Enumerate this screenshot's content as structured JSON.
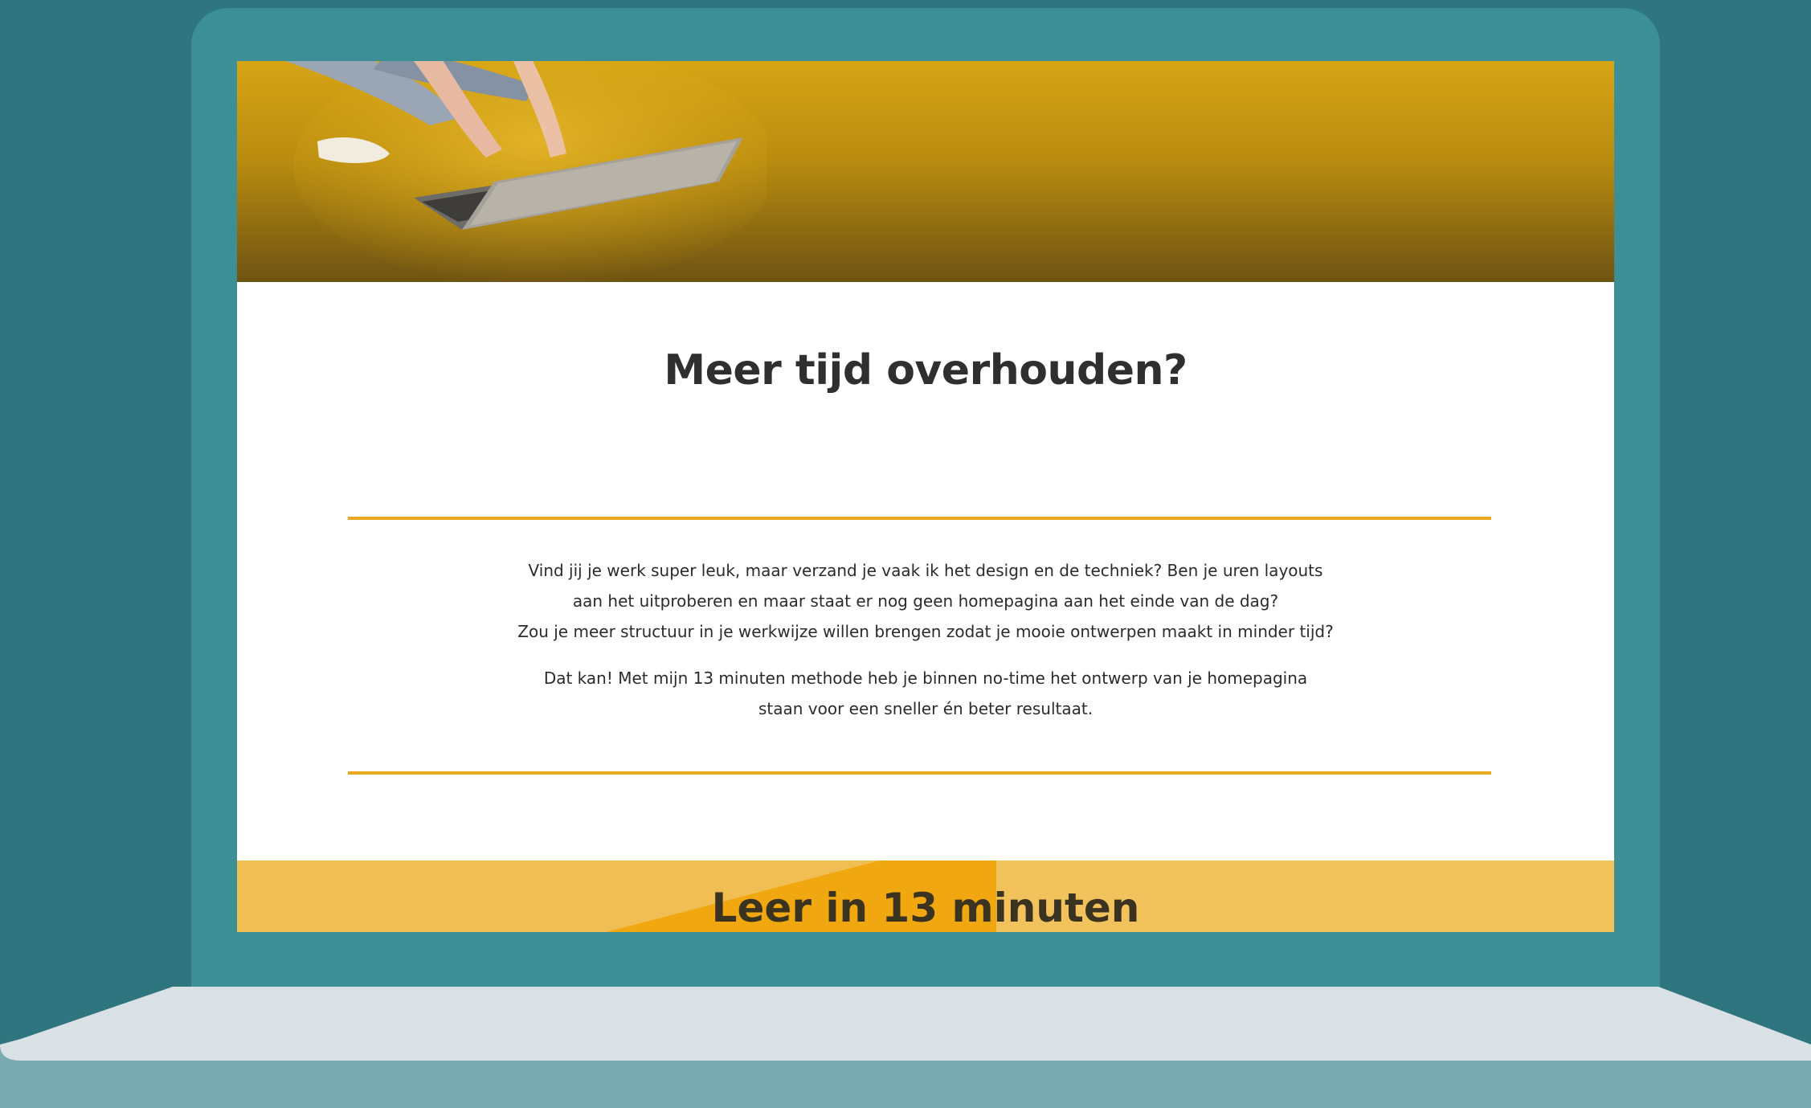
{
  "hero": {
    "image_description": "person-typing-on-laptop-photo"
  },
  "main": {
    "title": "Meer tijd overhouden?",
    "paragraph_1_lines": [
      "Vind jij je werk super leuk, maar verzand je vaak ik het design en de techniek? Ben je uren layouts",
      "aan het uitproberen en maar staat er nog geen homepagina aan het einde van de dag?",
      "Zou je meer structuur in je werkwijze willen brengen zodat je mooie ontwerpen maakt in minder tijd?"
    ],
    "paragraph_2_lines": [
      "Dat kan! Met mijn 13 minuten methode heb je binnen no-time het ontwerp van je homepagina",
      "staan voor een sneller én beter resultaat."
    ]
  },
  "cta": {
    "title": "Leer in 13 minuten"
  },
  "colors": {
    "background": "#2f7580",
    "laptop_frame": "#3b8f95",
    "accent": "#eaa822",
    "section_yellow": "#f0be52",
    "title_text": "#2f2f2f"
  }
}
